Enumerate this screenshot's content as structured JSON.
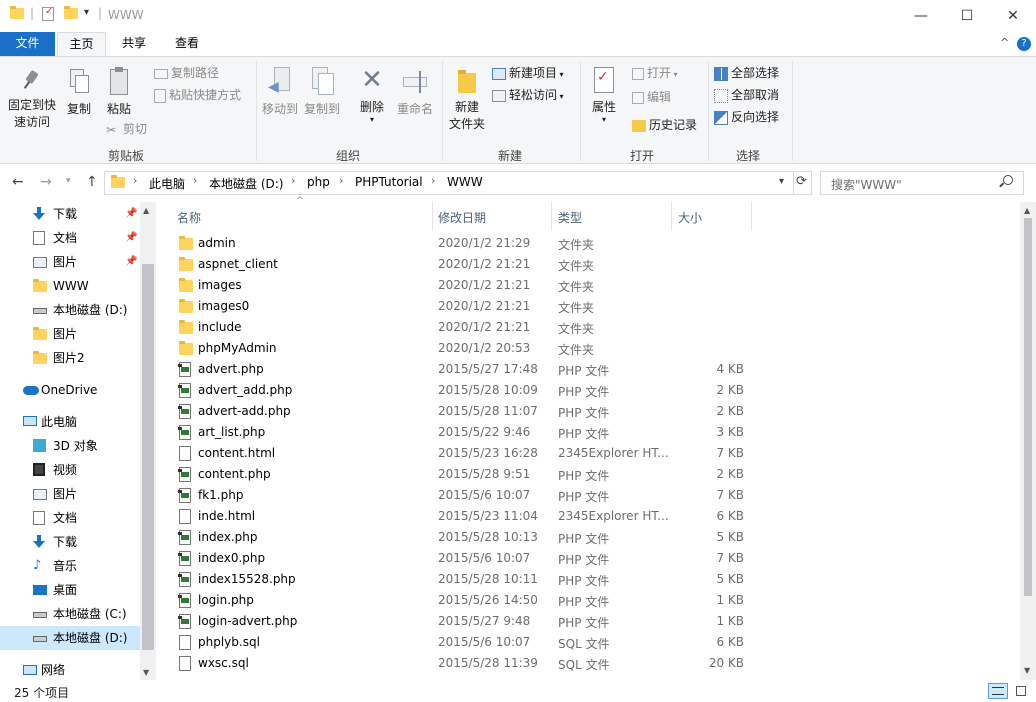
{
  "window": {
    "title": "WWW",
    "min_symbol": "—",
    "max_symbol": "☐",
    "close_symbol": "✕",
    "help_symbol": "?",
    "collapse_symbol": "^"
  },
  "tabs": {
    "file": "文件",
    "home": "主页",
    "share": "共享",
    "view": "查看"
  },
  "ribbon": {
    "clipboard": {
      "label": "剪贴板",
      "pin_line1": "固定到快",
      "pin_line2": "速访问",
      "copy": "复制",
      "paste": "粘贴",
      "copy_path": "复制路径",
      "paste_shortcut": "粘贴快捷方式",
      "cut": "剪切"
    },
    "organize": {
      "label": "组织",
      "move_to": "移动到",
      "copy_to": "复制到",
      "delete": "删除",
      "rename": "重命名"
    },
    "new": {
      "label": "新建",
      "new_item": "新建项目",
      "easy_access": "轻松访问",
      "new_folder_line1": "新建",
      "new_folder_line2": "文件夹"
    },
    "open": {
      "label": "打开",
      "properties": "属性",
      "open": "打开",
      "edit": "编辑",
      "history": "历史记录"
    },
    "select": {
      "label": "选择",
      "select_all": "全部选择",
      "select_none": "全部取消",
      "invert": "反向选择"
    }
  },
  "address": {
    "crumbs": [
      "此电脑",
      "本地磁盘 (D:)",
      "php",
      "PHPTutorial",
      "WWW"
    ],
    "search_placeholder": "搜索\"WWW\""
  },
  "nav": [
    {
      "label": "下载",
      "icon": "download-icon",
      "pinned": true
    },
    {
      "label": "文档",
      "icon": "document-icon",
      "pinned": true
    },
    {
      "label": "图片",
      "icon": "picture-icon",
      "pinned": true
    },
    {
      "label": "WWW",
      "icon": "folder-icon",
      "pinned": false
    },
    {
      "label": "本地磁盘 (D:)",
      "icon": "drive-icon",
      "pinned": false
    },
    {
      "label": "图片",
      "icon": "folder-icon",
      "pinned": false
    },
    {
      "label": "图片2",
      "icon": "folder-icon",
      "pinned": false
    },
    {
      "label": "OneDrive",
      "icon": "cloud-icon",
      "pinned": false
    },
    {
      "label": "此电脑",
      "icon": "computer-icon",
      "pinned": false
    },
    {
      "label": "3D 对象",
      "icon": "cube-icon",
      "pinned": false
    },
    {
      "label": "视频",
      "icon": "video-icon",
      "pinned": false
    },
    {
      "label": "图片",
      "icon": "picture-icon",
      "pinned": false
    },
    {
      "label": "文档",
      "icon": "document-icon",
      "pinned": false
    },
    {
      "label": "下载",
      "icon": "download-icon",
      "pinned": false
    },
    {
      "label": "音乐",
      "icon": "music-icon",
      "pinned": false
    },
    {
      "label": "桌面",
      "icon": "desktop-icon",
      "pinned": false
    },
    {
      "label": "本地磁盘 (C:)",
      "icon": "drive-icon",
      "pinned": false
    },
    {
      "label": "本地磁盘 (D:)",
      "icon": "drive-icon",
      "pinned": false,
      "selected": true
    },
    {
      "label": "网络",
      "icon": "network-icon",
      "pinned": false
    }
  ],
  "columns": {
    "name": "名称",
    "date": "修改日期",
    "type": "类型",
    "size": "大小"
  },
  "files": [
    {
      "name": "admin",
      "date": "2020/1/2 21:29",
      "type": "文件夹",
      "size": "",
      "kind": "folder"
    },
    {
      "name": "aspnet_client",
      "date": "2020/1/2 21:21",
      "type": "文件夹",
      "size": "",
      "kind": "folder"
    },
    {
      "name": "images",
      "date": "2020/1/2 21:21",
      "type": "文件夹",
      "size": "",
      "kind": "folder"
    },
    {
      "name": "images0",
      "date": "2020/1/2 21:21",
      "type": "文件夹",
      "size": "",
      "kind": "folder"
    },
    {
      "name": "include",
      "date": "2020/1/2 21:21",
      "type": "文件夹",
      "size": "",
      "kind": "folder"
    },
    {
      "name": "phpMyAdmin",
      "date": "2020/1/2 20:53",
      "type": "文件夹",
      "size": "",
      "kind": "folder"
    },
    {
      "name": "advert.php",
      "date": "2015/5/27 17:48",
      "type": "PHP 文件",
      "size": "4 KB",
      "kind": "php"
    },
    {
      "name": "advert_add.php",
      "date": "2015/5/28 10:09",
      "type": "PHP 文件",
      "size": "2 KB",
      "kind": "php"
    },
    {
      "name": "advert-add.php",
      "date": "2015/5/28 11:07",
      "type": "PHP 文件",
      "size": "2 KB",
      "kind": "php"
    },
    {
      "name": "art_list.php",
      "date": "2015/5/22 9:46",
      "type": "PHP 文件",
      "size": "3 KB",
      "kind": "php"
    },
    {
      "name": "content.html",
      "date": "2015/5/23 16:28",
      "type": "2345Explorer HT...",
      "size": "7 KB",
      "kind": "doc"
    },
    {
      "name": "content.php",
      "date": "2015/5/28 9:51",
      "type": "PHP 文件",
      "size": "2 KB",
      "kind": "php"
    },
    {
      "name": "fk1.php",
      "date": "2015/5/6 10:07",
      "type": "PHP 文件",
      "size": "7 KB",
      "kind": "php"
    },
    {
      "name": "inde.html",
      "date": "2015/5/23 11:04",
      "type": "2345Explorer HT...",
      "size": "6 KB",
      "kind": "doc"
    },
    {
      "name": "index.php",
      "date": "2015/5/28 10:13",
      "type": "PHP 文件",
      "size": "5 KB",
      "kind": "php"
    },
    {
      "name": "index0.php",
      "date": "2015/5/6 10:07",
      "type": "PHP 文件",
      "size": "7 KB",
      "kind": "php"
    },
    {
      "name": "index15528.php",
      "date": "2015/5/28 10:11",
      "type": "PHP 文件",
      "size": "5 KB",
      "kind": "php"
    },
    {
      "name": "login.php",
      "date": "2015/5/26 14:50",
      "type": "PHP 文件",
      "size": "1 KB",
      "kind": "php"
    },
    {
      "name": "login-advert.php",
      "date": "2015/5/27 9:48",
      "type": "PHP 文件",
      "size": "1 KB",
      "kind": "php"
    },
    {
      "name": "phplyb.sql",
      "date": "2015/5/6 10:07",
      "type": "SQL 文件",
      "size": "6 KB",
      "kind": "doc"
    },
    {
      "name": "wxsc.sql",
      "date": "2015/5/28 11:39",
      "type": "SQL 文件",
      "size": "20 KB",
      "kind": "doc"
    }
  ],
  "status": {
    "item_count": "25 个项目"
  }
}
